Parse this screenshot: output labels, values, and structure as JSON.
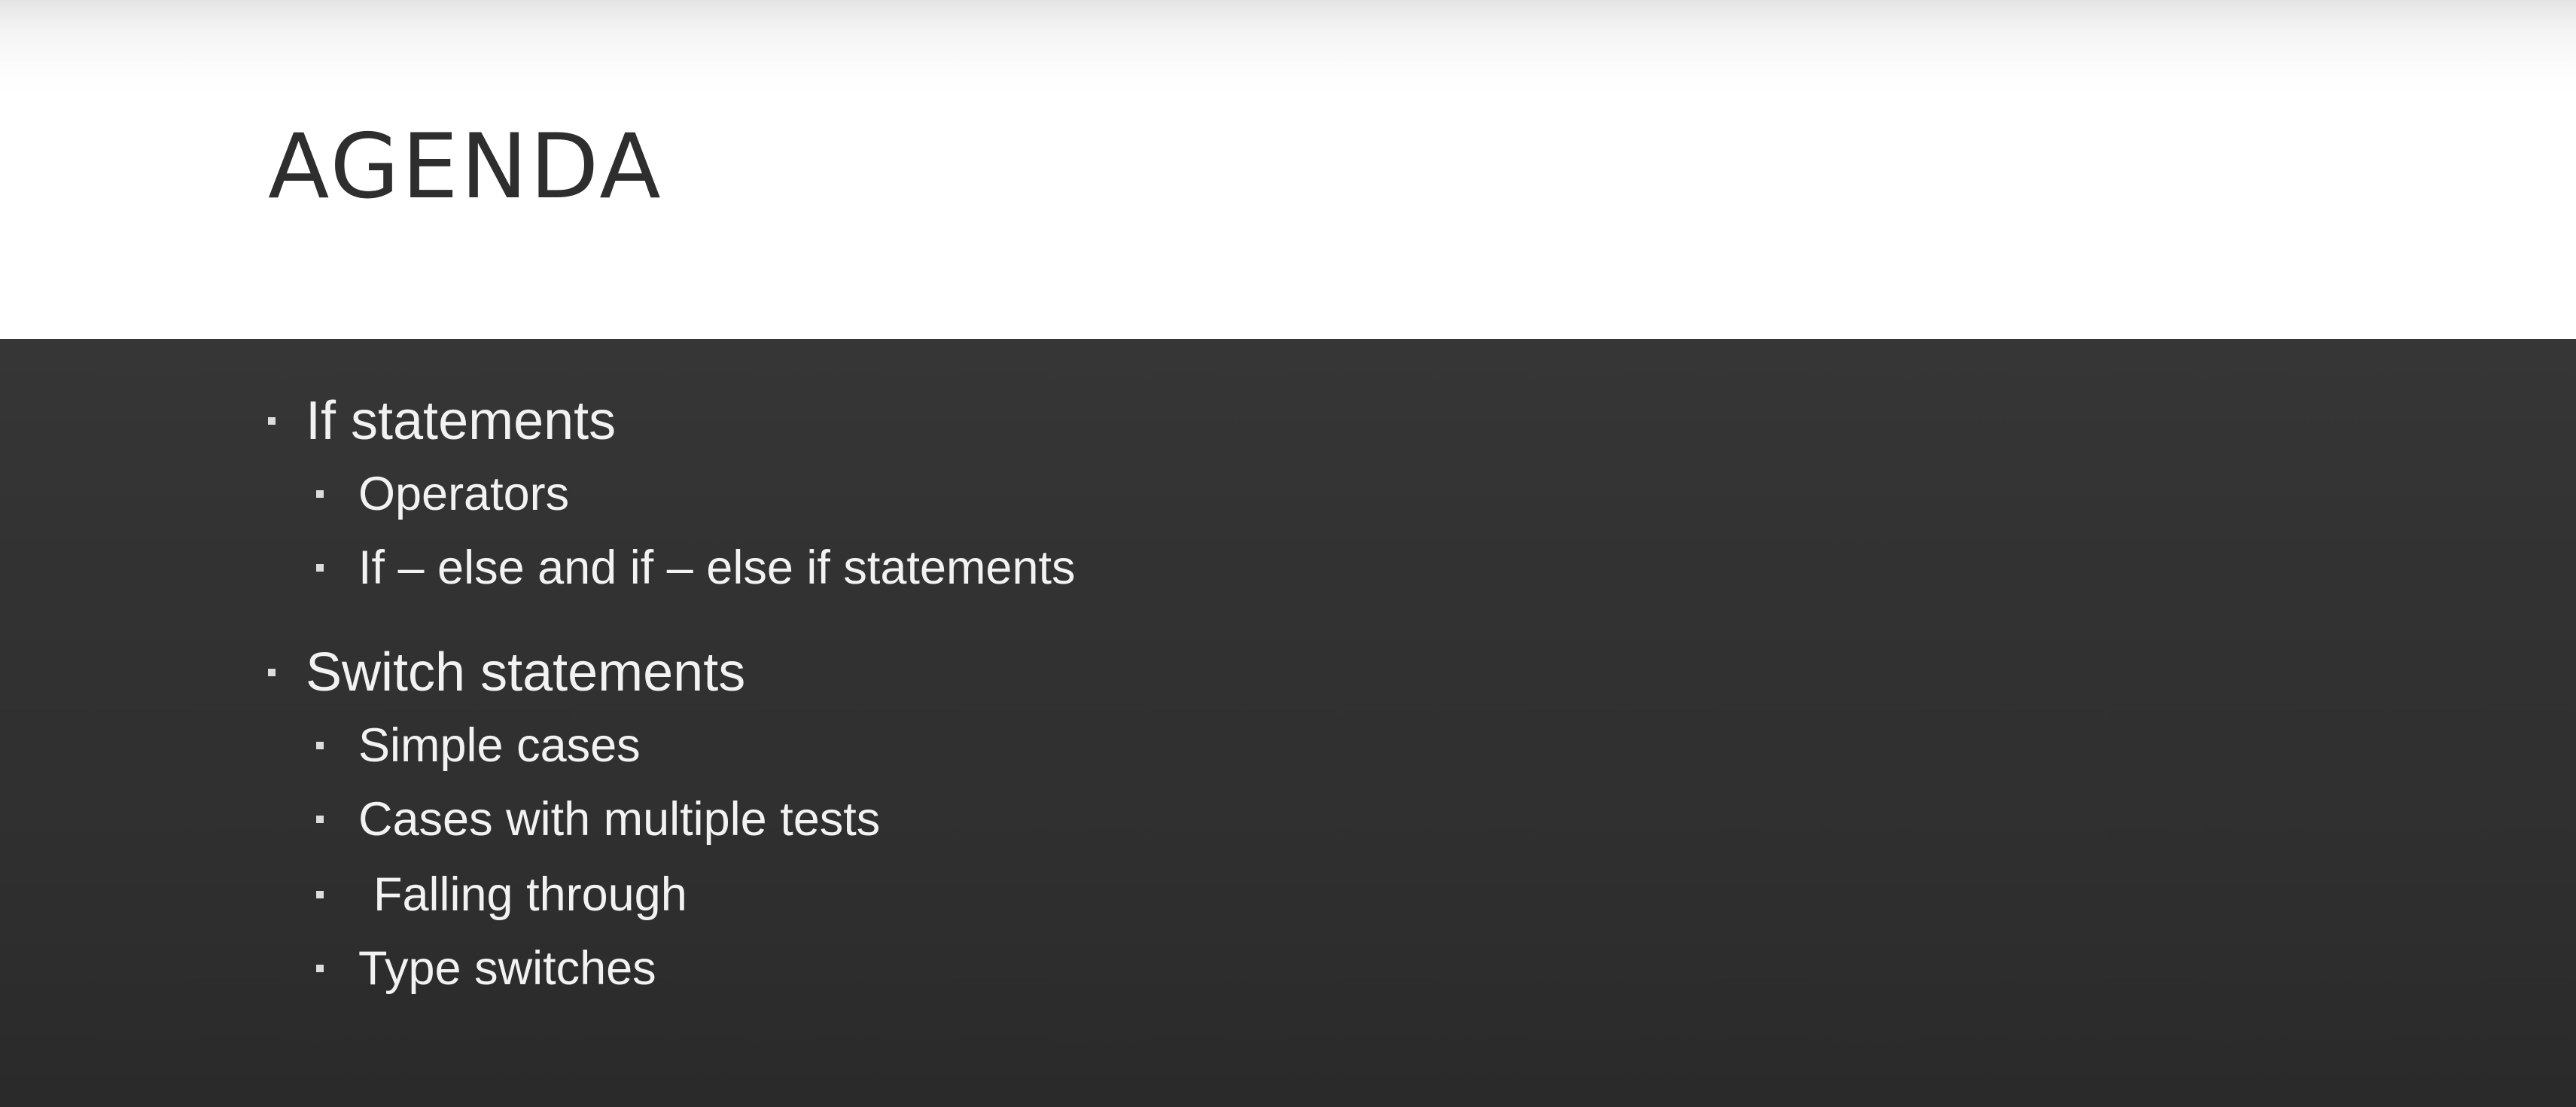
{
  "slide": {
    "title": "AGENDA",
    "sections": [
      {
        "label": "If statements",
        "items": [
          "Operators",
          "If – else and if – else if statements"
        ]
      },
      {
        "label": "Switch statements",
        "items": [
          "Simple cases",
          "Cases with multiple tests",
          "Falling through",
          "Type switches"
        ]
      }
    ]
  },
  "colors": {
    "title_background": "#ffffff",
    "title_text": "#2e2e2e",
    "content_background": "#323232",
    "content_text": "#f2f2f2"
  }
}
